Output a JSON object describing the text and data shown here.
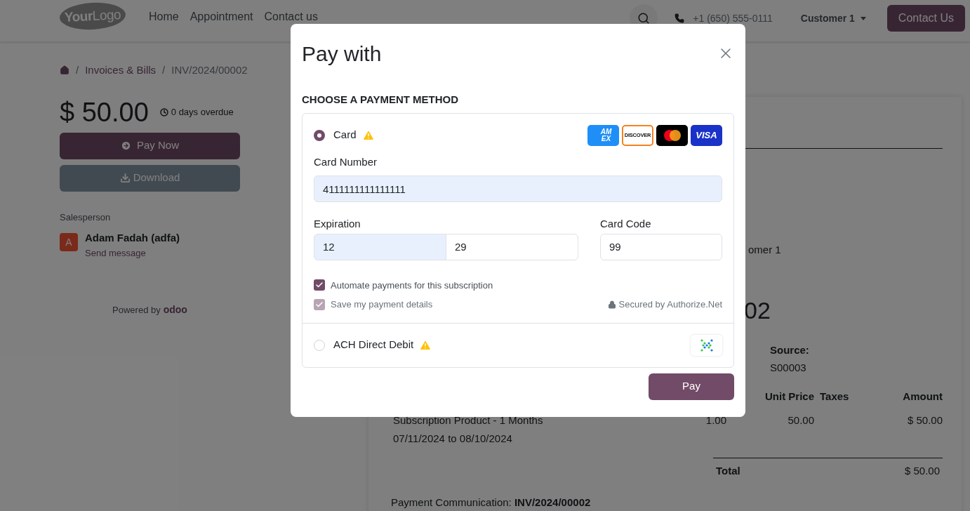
{
  "header": {
    "logo": "**Your**Logo",
    "nav": [
      {
        "label": "Home"
      },
      {
        "label": "Appointment"
      },
      {
        "label": "Contact us"
      }
    ],
    "phone": "+1 (650) 555-0111",
    "user_menu": "Customer 1",
    "cta": "Contact Us"
  },
  "breadcrumb": [
    {
      "kind": "separator",
      "text": "/"
    },
    {
      "kind": "link",
      "text": "Invoices & Bills"
    },
    {
      "kind": "separator",
      "text": "/"
    },
    {
      "kind": "current",
      "text": "INV/2024/00002"
    }
  ],
  "summary": {
    "amount": "$ 50.00",
    "overdue": "0 days overdue",
    "pay_button": "Pay Now",
    "download_button": "Download"
  },
  "salesperson": {
    "heading": "Salesperson",
    "avatar_letter": "A",
    "name": "Adam Fadah (adfa)",
    "action": "Send message"
  },
  "powered_by": {
    "text": "Powered by",
    "brand": "odoo"
  },
  "document": {
    "customer_fragment": "omer 1",
    "title_fragment": "02",
    "source_label": "Source:",
    "source": "S00003",
    "columns": [
      "Unit Price",
      "Taxes",
      "Amount"
    ],
    "lines": [
      {
        "description": "Subscription Product - 1 Months",
        "period": "07/11/2024 to 08/10/2024",
        "quantity": "1.00",
        "unit_price": "50.00",
        "amount": "$ 50.00"
      }
    ],
    "total_label": "Total",
    "total": "$ 50.00",
    "communication": "Payment Communication: **INV/2024/00002**"
  },
  "dialog": {
    "title": "Pay with",
    "section": "CHOOSE A PAYMENT METHOD",
    "methods": [
      {
        "kind": "card",
        "label": "Card",
        "selected": true,
        "warning": true,
        "brands": [
          {
            "kind": "amex",
            "label": "AM EX"
          },
          {
            "kind": "discover",
            "label": "DISCOVER"
          },
          {
            "kind": "mastercard"
          },
          {
            "kind": "visa",
            "label": "VISA"
          }
        ],
        "card_number": {
          "label": "Card Number",
          "value": "4111111111111111",
          "autofilled": true
        },
        "expiration": {
          "label": "Expiration",
          "month": {
            "value": "12",
            "autofilled": true
          },
          "year": {
            "value": "29",
            "autofilled": false
          }
        },
        "card_code": {
          "label": "Card Code",
          "value": "99",
          "autofilled": false
        },
        "options": [
          {
            "label": "Automate payments for this subscription",
            "checked": true,
            "disabled": false
          },
          {
            "label": "Save my payment details",
            "checked": true,
            "disabled": true
          }
        ],
        "secured": "Secured by Authorize.Net"
      },
      {
        "kind": "ach",
        "label": "ACH Direct Debit",
        "selected": false,
        "warning": true
      }
    ],
    "pay_button": "Pay"
  }
}
